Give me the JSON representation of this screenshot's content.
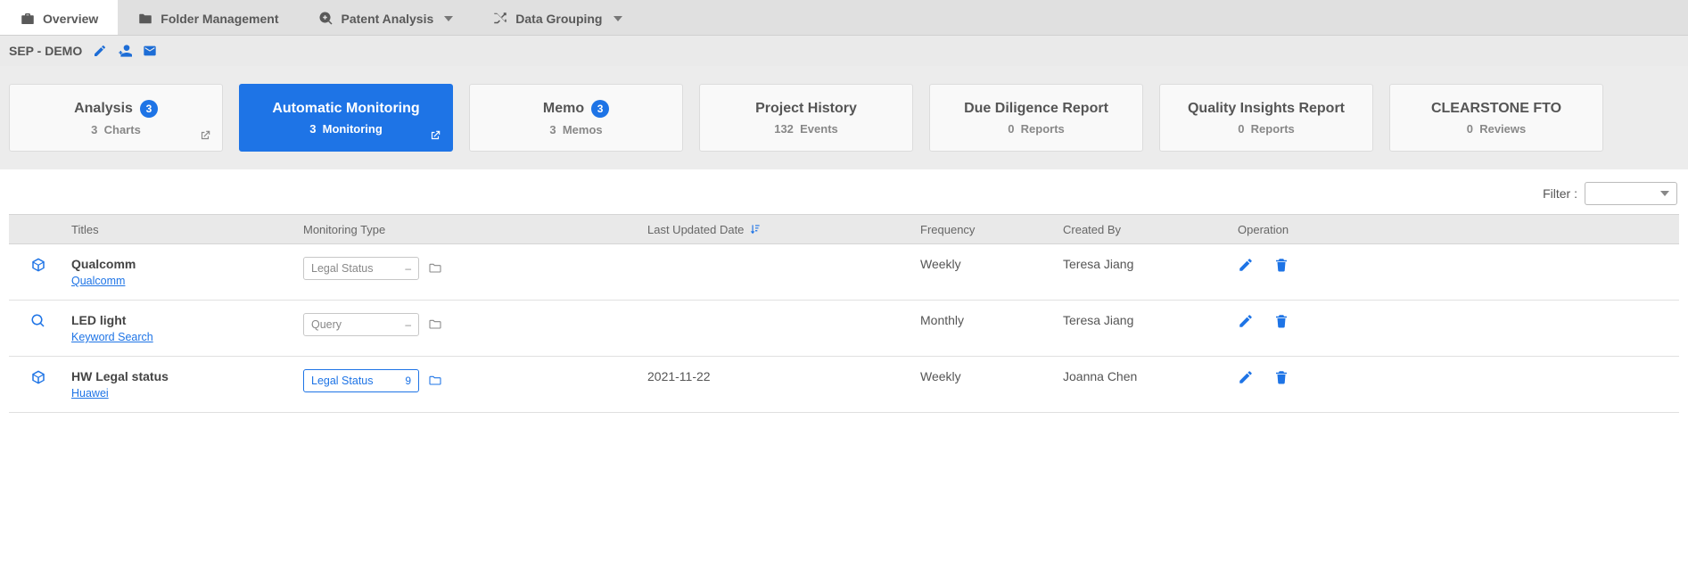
{
  "nav": {
    "tabs": [
      {
        "id": "overview",
        "label": "Overview",
        "icon": "briefcase",
        "active": true,
        "caret": false
      },
      {
        "id": "folder",
        "label": "Folder Management",
        "icon": "folder-tab",
        "active": false,
        "caret": false
      },
      {
        "id": "patent",
        "label": "Patent Analysis",
        "icon": "magnify-plus",
        "active": false,
        "caret": true
      },
      {
        "id": "group",
        "label": "Data Grouping",
        "icon": "shuffle",
        "active": false,
        "caret": true
      }
    ]
  },
  "project": {
    "name": "SEP - DEMO"
  },
  "cards": [
    {
      "id": "analysis",
      "title": "Analysis",
      "badge": "3",
      "sub_count": "3",
      "sub_unit": "Charts",
      "ext": true,
      "active": false
    },
    {
      "id": "monitoring",
      "title": "Automatic Monitoring",
      "badge": "",
      "sub_count": "3",
      "sub_unit": "Monitoring",
      "ext": true,
      "active": true
    },
    {
      "id": "memo",
      "title": "Memo",
      "badge": "3",
      "sub_count": "3",
      "sub_unit": "Memos",
      "ext": false,
      "active": false
    },
    {
      "id": "history",
      "title": "Project History",
      "badge": "",
      "sub_count": "132",
      "sub_unit": "Events",
      "ext": false,
      "active": false
    },
    {
      "id": "dd",
      "title": "Due Diligence Report",
      "badge": "",
      "sub_count": "0",
      "sub_unit": "Reports",
      "ext": false,
      "active": false
    },
    {
      "id": "qi",
      "title": "Quality Insights Report",
      "badge": "",
      "sub_count": "0",
      "sub_unit": "Reports",
      "ext": false,
      "active": false
    },
    {
      "id": "fto",
      "title": "CLEARSTONE FTO",
      "badge": "",
      "sub_count": "0",
      "sub_unit": "Reviews",
      "ext": false,
      "active": false
    }
  ],
  "filter": {
    "label": "Filter :"
  },
  "table": {
    "headers": {
      "titles": "Titles",
      "type": "Monitoring Type",
      "date": "Last Updated Date",
      "freq": "Frequency",
      "by": "Created By",
      "op": "Operation"
    },
    "rows": [
      {
        "icon": "cube",
        "title": "Qualcomm",
        "sub": "Qualcomm",
        "type_label": "Legal Status",
        "type_count": "–",
        "type_active": false,
        "date": "",
        "freq": "Weekly",
        "by": "Teresa Jiang"
      },
      {
        "icon": "search",
        "title": "LED light",
        "sub": "Keyword Search",
        "type_label": "Query",
        "type_count": "–",
        "type_active": false,
        "date": "",
        "freq": "Monthly",
        "by": "Teresa Jiang"
      },
      {
        "icon": "cube",
        "title": "HW Legal status",
        "sub": "Huawei",
        "type_label": "Legal Status",
        "type_count": "9",
        "type_active": true,
        "date": "2021-11-22",
        "freq": "Weekly",
        "by": "Joanna Chen"
      }
    ]
  }
}
